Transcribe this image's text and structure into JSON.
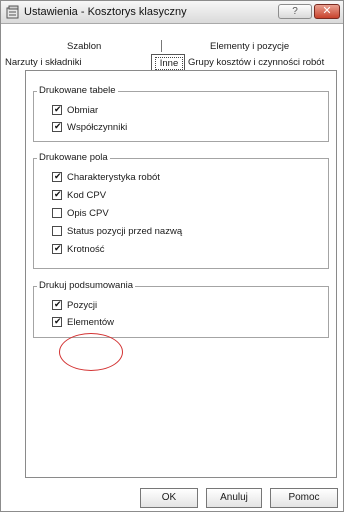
{
  "window": {
    "title": "Ustawienia - Kosztorys klasyczny",
    "help_label": "?",
    "close_label": "✕"
  },
  "tabs": {
    "row1": [
      "Szablon",
      "Elementy i pozycje"
    ],
    "row2": [
      "Narzuty i składniki",
      "Inne",
      "Grupy kosztów i czynności robót"
    ],
    "active": "Inne"
  },
  "groups": [
    {
      "title": "Drukowane tabele",
      "items": [
        {
          "label": "Obmiar",
          "checked": true
        },
        {
          "label": "Współczynniki",
          "checked": true
        }
      ]
    },
    {
      "title": "Drukowane pola",
      "items": [
        {
          "label": "Charakterystyka robót",
          "checked": true
        },
        {
          "label": "Kod CPV",
          "checked": true
        },
        {
          "label": "Opis CPV",
          "checked": false
        },
        {
          "label": "Status pozycji przed nazwą",
          "checked": false
        },
        {
          "label": "Krotność",
          "checked": true
        }
      ]
    },
    {
      "title": "Drukuj podsumowania",
      "items": [
        {
          "label": "Pozycji",
          "checked": true
        },
        {
          "label": "Elementów",
          "checked": true
        }
      ]
    }
  ],
  "buttons": {
    "ok": "OK",
    "cancel": "Anuluj",
    "help": "Pomoc"
  },
  "annotation_color": "#d33333"
}
